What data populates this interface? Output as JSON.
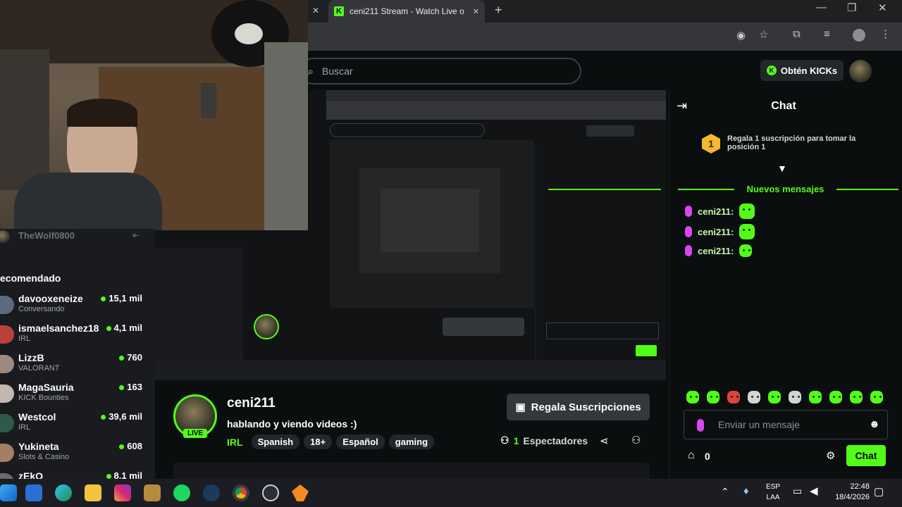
{
  "browser": {
    "tab_title": "ceni211 Stream - Watch Live o",
    "new_tab": "+",
    "close_tab": "✕"
  },
  "header": {
    "search_placeholder": "Buscar",
    "get_kicks_label": "Obtén KICKs"
  },
  "chat": {
    "title": "Chat",
    "gift_banner": "Regala 1 suscripción para tomar la posición 1",
    "gift_rank": "1",
    "new_messages_label": "Nuevos mensajes",
    "messages": [
      {
        "user": "ceni211:"
      },
      {
        "user": "ceni211:"
      },
      {
        "user": "ceni211:"
      }
    ],
    "input_placeholder": "Enviar un mensaje",
    "points": "0",
    "send_label": "Chat"
  },
  "sidebar": {
    "top_user": "TheWolf0800",
    "section_title": "ecomendado",
    "items": [
      {
        "name": "davooxeneize",
        "category": "Conversando",
        "viewers": "15,1 mil"
      },
      {
        "name": "ismaelsanchez18",
        "category": "IRL",
        "viewers": "4,1 mil"
      },
      {
        "name": "LizzB",
        "category": "VALORANT",
        "viewers": "760"
      },
      {
        "name": "MagaSauria",
        "category": "KICK Bounties",
        "viewers": "163"
      },
      {
        "name": "Westcol",
        "category": "IRL",
        "viewers": "39,6 mil"
      },
      {
        "name": "Yukineta",
        "category": "Slots & Casino",
        "viewers": "608"
      },
      {
        "name": "zEkO",
        "category": "",
        "viewers": "8,1 mil"
      }
    ]
  },
  "stream": {
    "streamer": "ceni211",
    "live_badge": "LIVE",
    "title": "hablando y viendo videos :)",
    "category": "IRL",
    "tags": [
      "Spanish",
      "18+",
      "Español",
      "gaming"
    ],
    "gift_button": "Regala Suscripciones",
    "viewers_count": "1",
    "viewers_label": "Espectadores"
  },
  "taskbar": {
    "lang_top": "ESP",
    "lang_bottom": "LAA",
    "time": "22:48",
    "date": "18/4/2026"
  },
  "colors": {
    "accent": "#53fc18",
    "background": "#0b0e0f",
    "panel": "#24272a"
  }
}
